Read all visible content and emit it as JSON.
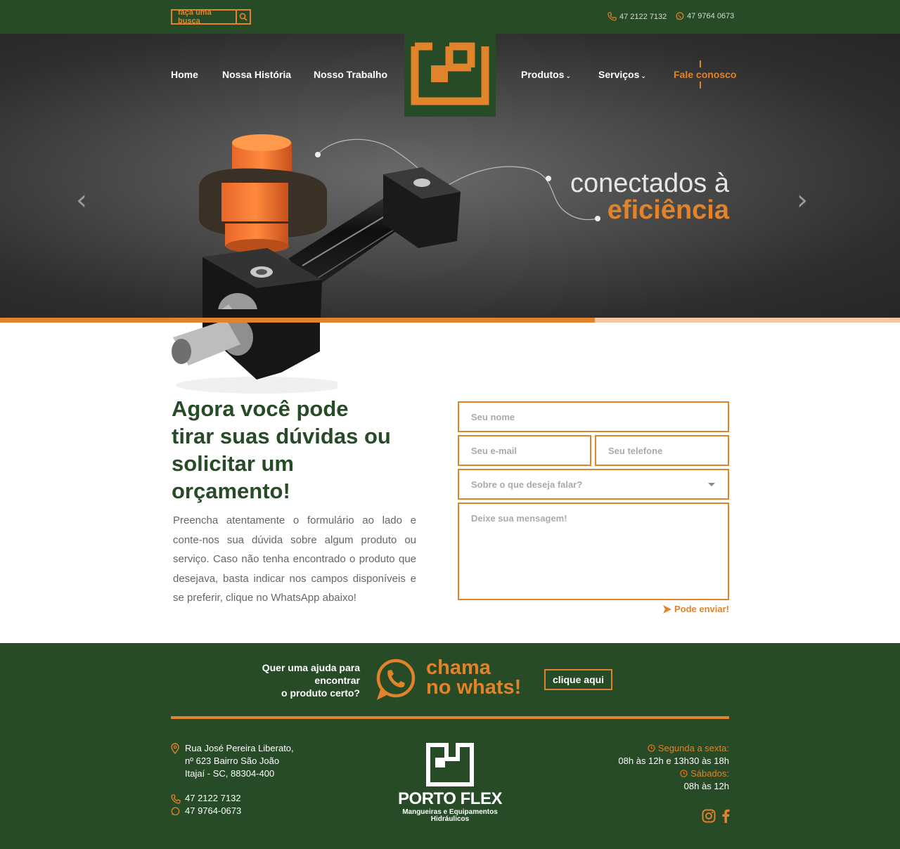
{
  "topbar": {
    "search_placeholder": "faça uma busca",
    "phone": "47 2122 7132",
    "whatsapp": "47 9764 0673",
    "icons": [
      "search-icon",
      "phone-icon",
      "whatsapp-icon"
    ]
  },
  "nav": {
    "home": "Home",
    "historia": "Nossa História",
    "trabalho": "Nosso Trabalho",
    "produtos": "Produtos",
    "servicos": "Serviços",
    "contato": "Fale conosco",
    "chevron": "⌄"
  },
  "hero": {
    "slogan_line1": "conectados à",
    "slogan_line2": "eficiência",
    "prev": "‹",
    "next": "›"
  },
  "contact": {
    "title": "Agora você pode tirar suas dúvidas ou solicitar um orçamento!",
    "text": "Preencha atentamente o formulário ao lado e conte-nos sua dúvida sobre algum produto ou serviço. Caso não tenha encontrado o produto que desejava, basta indicar nos campos disponíveis e se preferir, clique no WhatsApp abaixo!",
    "form": {
      "name_placeholder": "Seu nome",
      "email_placeholder": "Seu e-mail",
      "phone_placeholder": "Seu telefone",
      "subject_placeholder": "Sobre o que deseja falar?",
      "message_placeholder": "Deixe sua mensagem!",
      "submit": "Pode enviar!"
    }
  },
  "whats_banner": {
    "help_line1": "Quer uma ajuda para",
    "help_line2": "encontrar",
    "help_line3": "o produto certo?",
    "chama_line1": "chama",
    "chama_line2": "no whats!",
    "button": "clique aqui"
  },
  "footer": {
    "address_line1": "Rua José Pereira Liberato,",
    "address_line2": "nº 623 Bairro São João",
    "address_line3": "Itajaí - SC, 88304-400",
    "phone": "47 2122 7132",
    "whatsapp": "47 9764-0673",
    "brand_name": "PORTO FLEX",
    "brand_sub1": "Mangueiras e Equipamentos",
    "brand_sub2": "Hidráulicos",
    "weekday_label": "Segunda a sexta:",
    "weekday_hours": "08h às 12h e 13h30 às 18h",
    "saturday_label": "Sábados:",
    "saturday_hours": "08h às 12h",
    "social": [
      "instagram-icon",
      "facebook-icon"
    ]
  },
  "colors": {
    "green": "#264b26",
    "orange": "#e0832a",
    "dark": "#2e2e2e"
  }
}
